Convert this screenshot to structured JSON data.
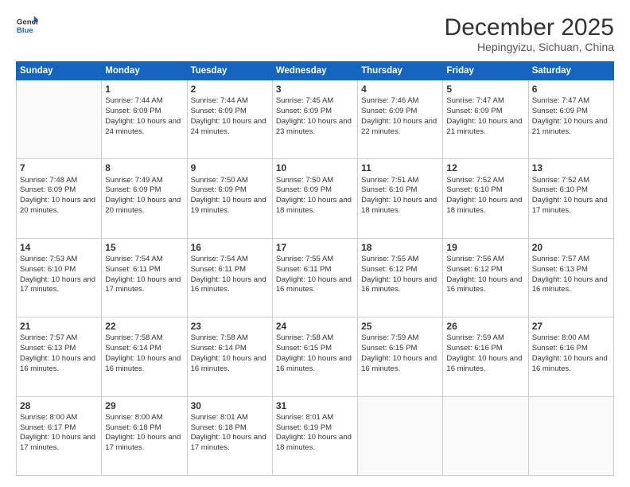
{
  "logo": {
    "line1": "General",
    "line2": "Blue"
  },
  "title": "December 2025",
  "location": "Hepingyizu, Sichuan, China",
  "days_of_week": [
    "Sunday",
    "Monday",
    "Tuesday",
    "Wednesday",
    "Thursday",
    "Friday",
    "Saturday"
  ],
  "weeks": [
    [
      {
        "day": "",
        "info": ""
      },
      {
        "day": "1",
        "info": "Sunrise: 7:44 AM\nSunset: 6:09 PM\nDaylight: 10 hours and 24 minutes."
      },
      {
        "day": "2",
        "info": "Sunrise: 7:44 AM\nSunset: 6:09 PM\nDaylight: 10 hours and 24 minutes."
      },
      {
        "day": "3",
        "info": "Sunrise: 7:45 AM\nSunset: 6:09 PM\nDaylight: 10 hours and 23 minutes."
      },
      {
        "day": "4",
        "info": "Sunrise: 7:46 AM\nSunset: 6:09 PM\nDaylight: 10 hours and 22 minutes."
      },
      {
        "day": "5",
        "info": "Sunrise: 7:47 AM\nSunset: 6:09 PM\nDaylight: 10 hours and 21 minutes."
      },
      {
        "day": "6",
        "info": "Sunrise: 7:47 AM\nSunset: 6:09 PM\nDaylight: 10 hours and 21 minutes."
      }
    ],
    [
      {
        "day": "7",
        "info": "Sunrise: 7:48 AM\nSunset: 6:09 PM\nDaylight: 10 hours and 20 minutes."
      },
      {
        "day": "8",
        "info": "Sunrise: 7:49 AM\nSunset: 6:09 PM\nDaylight: 10 hours and 20 minutes."
      },
      {
        "day": "9",
        "info": "Sunrise: 7:50 AM\nSunset: 6:09 PM\nDaylight: 10 hours and 19 minutes."
      },
      {
        "day": "10",
        "info": "Sunrise: 7:50 AM\nSunset: 6:09 PM\nDaylight: 10 hours and 18 minutes."
      },
      {
        "day": "11",
        "info": "Sunrise: 7:51 AM\nSunset: 6:10 PM\nDaylight: 10 hours and 18 minutes."
      },
      {
        "day": "12",
        "info": "Sunrise: 7:52 AM\nSunset: 6:10 PM\nDaylight: 10 hours and 18 minutes."
      },
      {
        "day": "13",
        "info": "Sunrise: 7:52 AM\nSunset: 6:10 PM\nDaylight: 10 hours and 17 minutes."
      }
    ],
    [
      {
        "day": "14",
        "info": "Sunrise: 7:53 AM\nSunset: 6:10 PM\nDaylight: 10 hours and 17 minutes."
      },
      {
        "day": "15",
        "info": "Sunrise: 7:54 AM\nSunset: 6:11 PM\nDaylight: 10 hours and 17 minutes."
      },
      {
        "day": "16",
        "info": "Sunrise: 7:54 AM\nSunset: 6:11 PM\nDaylight: 10 hours and 16 minutes."
      },
      {
        "day": "17",
        "info": "Sunrise: 7:55 AM\nSunset: 6:11 PM\nDaylight: 10 hours and 16 minutes."
      },
      {
        "day": "18",
        "info": "Sunrise: 7:55 AM\nSunset: 6:12 PM\nDaylight: 10 hours and 16 minutes."
      },
      {
        "day": "19",
        "info": "Sunrise: 7:56 AM\nSunset: 6:12 PM\nDaylight: 10 hours and 16 minutes."
      },
      {
        "day": "20",
        "info": "Sunrise: 7:57 AM\nSunset: 6:13 PM\nDaylight: 10 hours and 16 minutes."
      }
    ],
    [
      {
        "day": "21",
        "info": "Sunrise: 7:57 AM\nSunset: 6:13 PM\nDaylight: 10 hours and 16 minutes."
      },
      {
        "day": "22",
        "info": "Sunrise: 7:58 AM\nSunset: 6:14 PM\nDaylight: 10 hours and 16 minutes."
      },
      {
        "day": "23",
        "info": "Sunrise: 7:58 AM\nSunset: 6:14 PM\nDaylight: 10 hours and 16 minutes."
      },
      {
        "day": "24",
        "info": "Sunrise: 7:58 AM\nSunset: 6:15 PM\nDaylight: 10 hours and 16 minutes."
      },
      {
        "day": "25",
        "info": "Sunrise: 7:59 AM\nSunset: 6:15 PM\nDaylight: 10 hours and 16 minutes."
      },
      {
        "day": "26",
        "info": "Sunrise: 7:59 AM\nSunset: 6:16 PM\nDaylight: 10 hours and 16 minutes."
      },
      {
        "day": "27",
        "info": "Sunrise: 8:00 AM\nSunset: 6:16 PM\nDaylight: 10 hours and 16 minutes."
      }
    ],
    [
      {
        "day": "28",
        "info": "Sunrise: 8:00 AM\nSunset: 6:17 PM\nDaylight: 10 hours and 17 minutes."
      },
      {
        "day": "29",
        "info": "Sunrise: 8:00 AM\nSunset: 6:18 PM\nDaylight: 10 hours and 17 minutes."
      },
      {
        "day": "30",
        "info": "Sunrise: 8:01 AM\nSunset: 6:18 PM\nDaylight: 10 hours and 17 minutes."
      },
      {
        "day": "31",
        "info": "Sunrise: 8:01 AM\nSunset: 6:19 PM\nDaylight: 10 hours and 18 minutes."
      },
      {
        "day": "",
        "info": ""
      },
      {
        "day": "",
        "info": ""
      },
      {
        "day": "",
        "info": ""
      }
    ]
  ]
}
